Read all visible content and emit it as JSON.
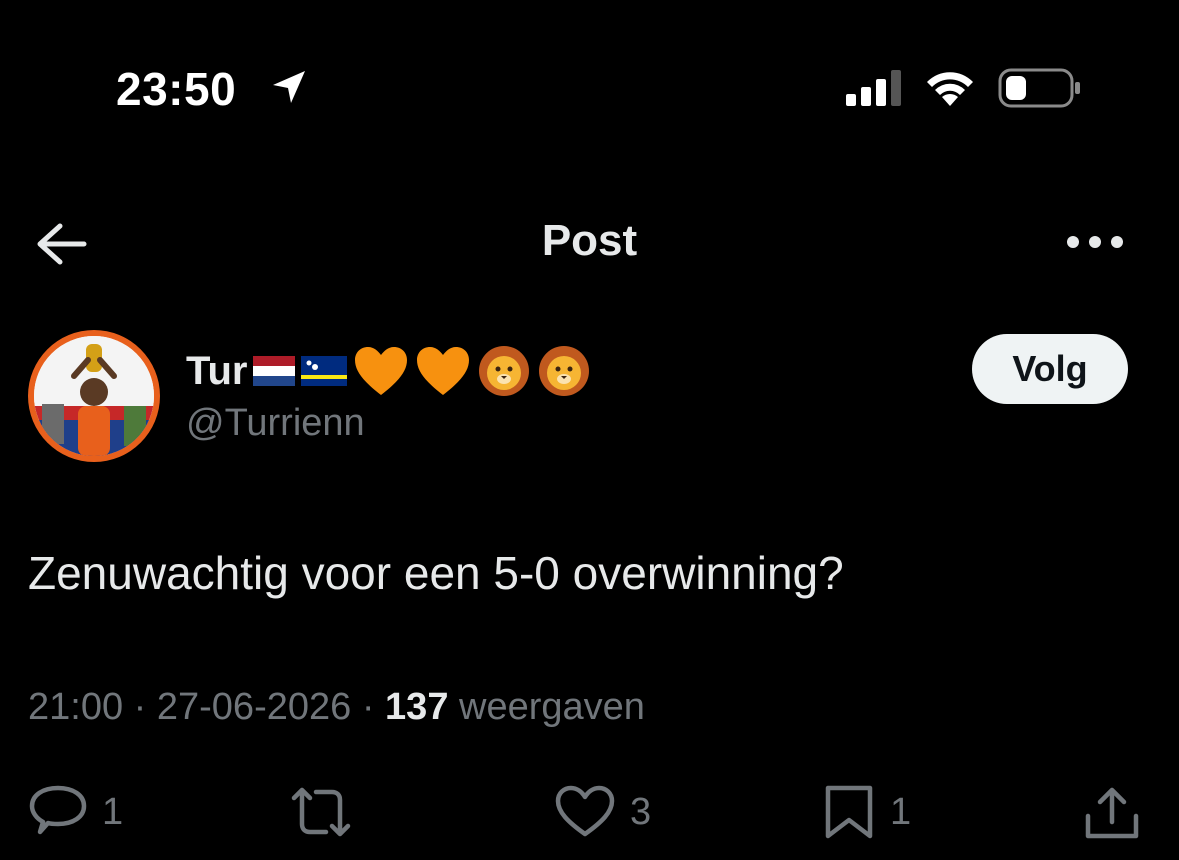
{
  "status_bar": {
    "time": "23:50",
    "location_icon": "location-arrow-icon",
    "signal_icon": "cellular-signal-icon",
    "wifi_icon": "wifi-icon",
    "battery_icon": "battery-low-icon"
  },
  "header": {
    "title": "Post",
    "back_icon": "arrow-left-icon",
    "more_icon": "more-horizontal-icon"
  },
  "author": {
    "display_name": "Tur",
    "name_emoji": [
      "flag-netherlands",
      "flag-curacao",
      "orange-heart",
      "orange-heart",
      "lion-face",
      "lion-face"
    ],
    "handle": "@Turrienn",
    "follow_label": "Volg"
  },
  "post": {
    "text": "Zenuwachtig voor een 5-0 overwinning?",
    "time": "21:00",
    "sep1": "·",
    "date": "27-06-2026",
    "sep2": "·",
    "views": "137",
    "views_label": "weergaven"
  },
  "actions": {
    "reply": {
      "icon": "reply-icon",
      "count": "1"
    },
    "repost": {
      "icon": "repost-icon",
      "count": ""
    },
    "like": {
      "icon": "heart-icon",
      "count": "3"
    },
    "bookmark": {
      "icon": "bookmark-icon",
      "count": "1"
    },
    "share": {
      "icon": "share-icon"
    }
  },
  "colors": {
    "background": "#000000",
    "text": "#e7e9ea",
    "muted": "#71767b",
    "follow_bg": "#eff3f4",
    "avatar_ring": "#e8601c"
  }
}
